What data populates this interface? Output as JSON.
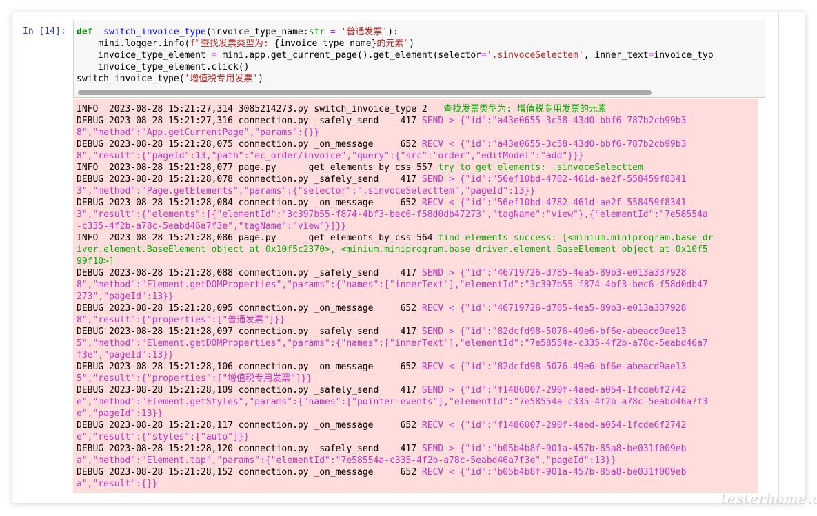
{
  "cell": {
    "prompt": "In [14]:",
    "code": [
      [
        [
          "kw",
          "def"
        ],
        [
          "",
          "  "
        ],
        [
          "fn",
          "switch_invoice_type"
        ],
        [
          "",
          "(invoice_type_name:"
        ],
        [
          "bi",
          "str"
        ],
        [
          "",
          " "
        ],
        [
          "op",
          "="
        ],
        [
          "",
          " "
        ],
        [
          "str",
          "'普通发票'"
        ],
        [
          "",
          "):"
        ]
      ],
      [
        [
          "",
          "    mini.logger.info("
        ],
        [
          "str",
          "f\"查找发票类型为: "
        ],
        [
          "",
          "{invoice_type_name}"
        ],
        [
          "str",
          "的元素\""
        ],
        [
          "",
          ")"
        ]
      ],
      [
        [
          "",
          "    invoice_type_element "
        ],
        [
          "op",
          "="
        ],
        [
          "",
          " mini.app.get_current_page().get_element(selector"
        ],
        [
          "op",
          "="
        ],
        [
          "str",
          "'.sinvoceSelectem'"
        ],
        [
          "",
          ", inner_text"
        ],
        [
          "op",
          "="
        ],
        [
          "",
          "invoice_typ"
        ]
      ],
      [
        [
          "",
          "    invoice_type_element.click()"
        ]
      ],
      [
        [
          "",
          "switch_invoice_type("
        ],
        [
          "str",
          "'增值税专用发票'"
        ],
        [
          "",
          ")"
        ]
      ]
    ]
  },
  "output": {
    "lines": [
      [
        [
          "",
          "INFO  2023-08-28 15:21:27,314 3085214273.py switch_invoice_type 2   "
        ],
        [
          "g",
          "查找发票类型为: 增值税专用发票的元素"
        ]
      ],
      [
        [
          "",
          "DEBUG 2023-08-28 15:21:27,316 connection.py _safely_send    417 "
        ],
        [
          "m",
          "SEND > {\"id\":\"a43e0655-3c58-43d0-bbf6-787b2cb99b3"
        ]
      ],
      [
        [
          "m",
          "8\",\"method\":\"App.getCurrentPage\",\"params\":{}}"
        ]
      ],
      [
        [
          "",
          "DEBUG 2023-08-28 15:21:28,075 connection.py _on_message     652 "
        ],
        [
          "m",
          "RECV < {\"id\":\"a43e0655-3c58-43d0-bbf6-787b2cb99b3"
        ]
      ],
      [
        [
          "m",
          "8\",\"result\":{\"pageId\":13,\"path\":\"ec_order/invoice\",\"query\":{\"src\":\"order\",\"editModel\":\"add\"}}}"
        ]
      ],
      [
        [
          "",
          "INFO  2023-08-28 15:21:28,077 page.py     _get_elements_by_css 557 "
        ],
        [
          "g",
          "try to get elements: .sinvoceSelecttem"
        ]
      ],
      [
        [
          "",
          "DEBUG 2023-08-28 15:21:28,078 connection.py _safely_send    417 "
        ],
        [
          "m",
          "SEND > {\"id\":\"56ef10bd-4782-461d-ae2f-558459f8341"
        ]
      ],
      [
        [
          "m",
          "3\",\"method\":\"Page.getElements\",\"params\":{\"selector\":\".sinvoceSelecttem\",\"pageId\":13}}"
        ]
      ],
      [
        [
          "",
          "DEBUG 2023-08-28 15:21:28,084 connection.py _on_message     652 "
        ],
        [
          "m",
          "RECV < {\"id\":\"56ef10bd-4782-461d-ae2f-558459f8341"
        ]
      ],
      [
        [
          "m",
          "3\",\"result\":{\"elements\":[{\"elementId\":\"3c397b55-f874-4bf3-bec6-f58d0db47273\",\"tagName\":\"view\"},{\"elementId\":\"7e58554a"
        ]
      ],
      [
        [
          "m",
          "-c335-4f2b-a78c-5eabd46a7f3e\",\"tagName\":\"view\"}]}}"
        ]
      ],
      [
        [
          "",
          "INFO  2023-08-28 15:21:28,086 page.py     _get_elements_by_css 564 "
        ],
        [
          "g",
          "find elements success: [<minium.miniprogram.base_dr"
        ]
      ],
      [
        [
          "g",
          "iver.element.BaseElement object at 0x10f5c2370>, <minium.miniprogram.base_driver.element.BaseElement object at 0x10f5"
        ]
      ],
      [
        [
          "g",
          "99f10>]"
        ]
      ],
      [
        [
          "",
          "DEBUG 2023-08-28 15:21:28,088 connection.py _safely_send    417 "
        ],
        [
          "m",
          "SEND > {\"id\":\"46719726-d785-4ea5-89b3-e013a337928"
        ]
      ],
      [
        [
          "m",
          "8\",\"method\":\"Element.getDOMProperties\",\"params\":{\"names\":[\"innerText\"],\"elementId\":\"3c397b55-f874-4bf3-bec6-f58d0db47"
        ]
      ],
      [
        [
          "m",
          "273\",\"pageId\":13}}"
        ]
      ],
      [
        [
          "",
          "DEBUG 2023-08-28 15:21:28,095 connection.py _on_message     652 "
        ],
        [
          "m",
          "RECV < {\"id\":\"46719726-d785-4ea5-89b3-e013a337928"
        ]
      ],
      [
        [
          "m",
          "8\",\"result\":{\"properties\":[\"普通发票\"]}}"
        ]
      ],
      [
        [
          "",
          "DEBUG 2023-08-28 15:21:28,097 connection.py _safely_send    417 "
        ],
        [
          "m",
          "SEND > {\"id\":\"82dcfd98-5076-49e6-bf6e-abeacd9ae13"
        ]
      ],
      [
        [
          "m",
          "5\",\"method\":\"Element.getDOMProperties\",\"params\":{\"names\":[\"innerText\"],\"elementId\":\"7e58554a-c335-4f2b-a78c-5eabd46a7"
        ]
      ],
      [
        [
          "m",
          "f3e\",\"pageId\":13}}"
        ]
      ],
      [
        [
          "",
          "DEBUG 2023-08-28 15:21:28,106 connection.py _on_message     652 "
        ],
        [
          "m",
          "RECV < {\"id\":\"82dcfd98-5076-49e6-bf6e-abeacd9ae13"
        ]
      ],
      [
        [
          "m",
          "5\",\"result\":{\"properties\":[\"增值税专用发票\"]}}"
        ]
      ],
      [
        [
          "",
          "DEBUG 2023-08-28 15:21:28,109 connection.py _safely_send    417 "
        ],
        [
          "m",
          "SEND > {\"id\":\"f1486007-290f-4aed-a054-1fcde6f2742"
        ]
      ],
      [
        [
          "m",
          "e\",\"method\":\"Element.getStyles\",\"params\":{\"names\":[\"pointer-events\"],\"elementId\":\"7e58554a-c335-4f2b-a78c-5eabd46a7f3"
        ]
      ],
      [
        [
          "m",
          "e\",\"pageId\":13}}"
        ]
      ],
      [
        [
          "",
          "DEBUG 2023-08-28 15:21:28,117 connection.py _on_message     652 "
        ],
        [
          "m",
          "RECV < {\"id\":\"f1486007-290f-4aed-a054-1fcde6f2742"
        ]
      ],
      [
        [
          "m",
          "e\",\"result\":{\"styles\":[\"auto\"]}}"
        ]
      ],
      [
        [
          "",
          "DEBUG 2023-08-28 15:21:28,120 connection.py _safely_send    417 "
        ],
        [
          "m",
          "SEND > {\"id\":\"b05b4b8f-901a-457b-85a8-be031f009eb"
        ]
      ],
      [
        [
          "m",
          "a\",\"method\":\"Element.tap\",\"params\":{\"elementId\":\"7e58554a-c335-4f2b-a78c-5eabd46a7f3e\",\"pageId\":13}}"
        ]
      ],
      [
        [
          "",
          "DEBUG 2023-08-28 15:21:28,152 connection.py _on_message     652 "
        ],
        [
          "m",
          "RECV < {\"id\":\"b05b4b8f-901a-457b-85a8-be031f009eb"
        ]
      ],
      [
        [
          "m",
          "a\",\"result\":{}}"
        ]
      ]
    ]
  },
  "watermark": "testerhome.com",
  "colors": {
    "prompt": "#303f9f",
    "output_background": "#ffdddd",
    "log_green": "#00aa00",
    "log_magenta": "#c035c0"
  }
}
